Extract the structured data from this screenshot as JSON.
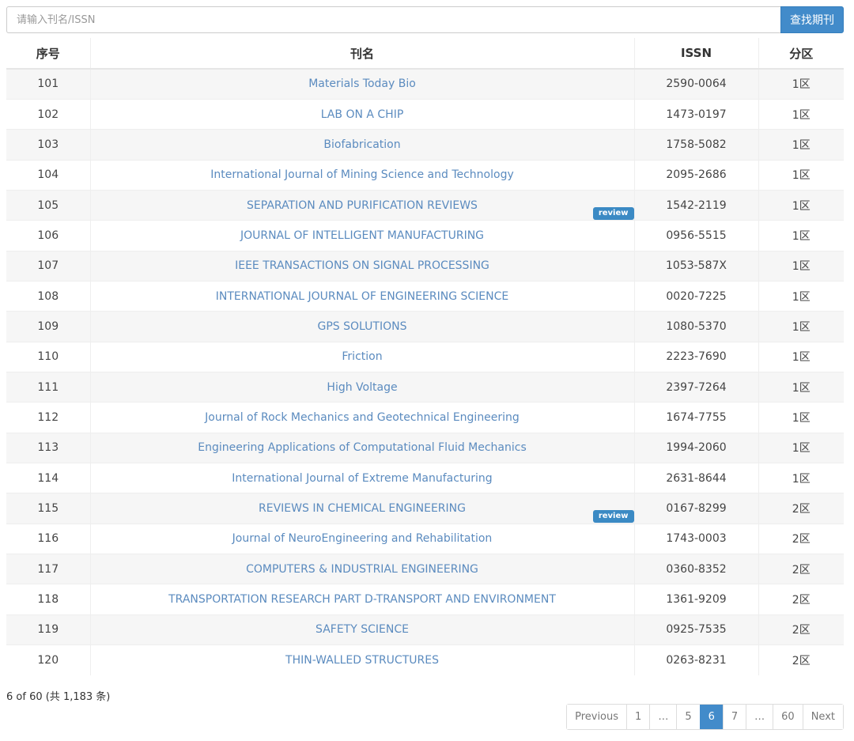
{
  "search": {
    "placeholder": "请输入刊名/ISSN",
    "button": "查找期刊"
  },
  "table": {
    "headers": [
      "序号",
      "刊名",
      "ISSN",
      "分区"
    ],
    "rows": [
      {
        "no": "101",
        "name": "Materials Today Bio",
        "issn": "2590-0064",
        "zone": "1区",
        "badge": ""
      },
      {
        "no": "102",
        "name": "LAB ON A CHIP",
        "issn": "1473-0197",
        "zone": "1区",
        "badge": ""
      },
      {
        "no": "103",
        "name": "Biofabrication",
        "issn": "1758-5082",
        "zone": "1区",
        "badge": ""
      },
      {
        "no": "104",
        "name": "International Journal of Mining Science and Technology",
        "issn": "2095-2686",
        "zone": "1区",
        "badge": ""
      },
      {
        "no": "105",
        "name": "SEPARATION AND PURIFICATION REVIEWS",
        "issn": "1542-2119",
        "zone": "1区",
        "badge": "review"
      },
      {
        "no": "106",
        "name": "JOURNAL OF INTELLIGENT MANUFACTURING",
        "issn": "0956-5515",
        "zone": "1区",
        "badge": ""
      },
      {
        "no": "107",
        "name": "IEEE TRANSACTIONS ON SIGNAL PROCESSING",
        "issn": "1053-587X",
        "zone": "1区",
        "badge": ""
      },
      {
        "no": "108",
        "name": "INTERNATIONAL JOURNAL OF ENGINEERING SCIENCE",
        "issn": "0020-7225",
        "zone": "1区",
        "badge": ""
      },
      {
        "no": "109",
        "name": "GPS SOLUTIONS",
        "issn": "1080-5370",
        "zone": "1区",
        "badge": ""
      },
      {
        "no": "110",
        "name": "Friction",
        "issn": "2223-7690",
        "zone": "1区",
        "badge": ""
      },
      {
        "no": "111",
        "name": "High Voltage",
        "issn": "2397-7264",
        "zone": "1区",
        "badge": ""
      },
      {
        "no": "112",
        "name": "Journal of Rock Mechanics and Geotechnical Engineering",
        "issn": "1674-7755",
        "zone": "1区",
        "badge": ""
      },
      {
        "no": "113",
        "name": "Engineering Applications of Computational Fluid Mechanics",
        "issn": "1994-2060",
        "zone": "1区",
        "badge": ""
      },
      {
        "no": "114",
        "name": "International Journal of Extreme Manufacturing",
        "issn": "2631-8644",
        "zone": "1区",
        "badge": ""
      },
      {
        "no": "115",
        "name": "REVIEWS IN CHEMICAL ENGINEERING",
        "issn": "0167-8299",
        "zone": "2区",
        "badge": "review"
      },
      {
        "no": "116",
        "name": "Journal of NeuroEngineering and Rehabilitation",
        "issn": "1743-0003",
        "zone": "2区",
        "badge": ""
      },
      {
        "no": "117",
        "name": "COMPUTERS & INDUSTRIAL ENGINEERING",
        "issn": "0360-8352",
        "zone": "2区",
        "badge": ""
      },
      {
        "no": "118",
        "name": "TRANSPORTATION RESEARCH PART D-TRANSPORT AND ENVIRONMENT",
        "issn": "1361-9209",
        "zone": "2区",
        "badge": ""
      },
      {
        "no": "119",
        "name": "SAFETY SCIENCE",
        "issn": "0925-7535",
        "zone": "2区",
        "badge": ""
      },
      {
        "no": "120",
        "name": "THIN-WALLED STRUCTURES",
        "issn": "0263-8231",
        "zone": "2区",
        "badge": ""
      }
    ]
  },
  "pagination": {
    "info": "6 of 60 (共 1,183 条)",
    "items": [
      {
        "label": "Previous",
        "active": false
      },
      {
        "label": "1",
        "active": false
      },
      {
        "label": "…",
        "active": false
      },
      {
        "label": "5",
        "active": false
      },
      {
        "label": "6",
        "active": true
      },
      {
        "label": "7",
        "active": false
      },
      {
        "label": "…",
        "active": false
      },
      {
        "label": "60",
        "active": false
      },
      {
        "label": "Next",
        "active": false
      }
    ]
  },
  "colors": {
    "accent": "#428bca",
    "link": "#5b8bbf",
    "badge": "#3b8ac4"
  }
}
